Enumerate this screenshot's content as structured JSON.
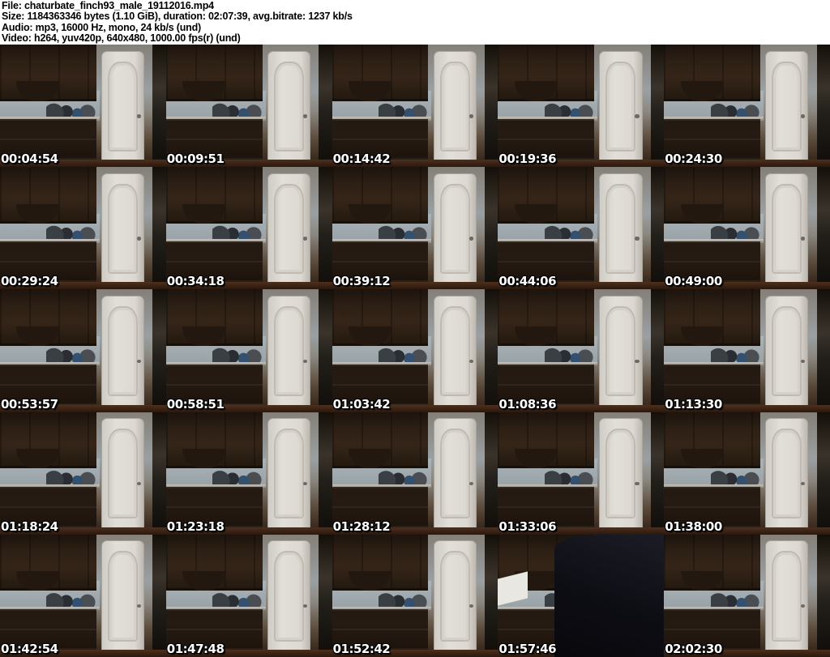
{
  "header": {
    "file_line": "File: chaturbate_finch93_male_19112016.mp4",
    "size_line": "Size: 1184363346 bytes (1.10 GiB), duration: 02:07:39, avg.bitrate: 1237 kb/s",
    "audio_line": "Audio: mp3, 16000 Hz, mono, 24 kb/s (und)",
    "video_line": "Video: h264, yuv420p, 640x480, 1000.00 fps(r) (und)"
  },
  "grid": {
    "columns": 5,
    "rows": 5,
    "thumbnails": [
      {
        "timestamp": "00:04:54",
        "variant": "kitchen"
      },
      {
        "timestamp": "00:09:51",
        "variant": "kitchen"
      },
      {
        "timestamp": "00:14:42",
        "variant": "kitchen"
      },
      {
        "timestamp": "00:19:36",
        "variant": "kitchen"
      },
      {
        "timestamp": "00:24:30",
        "variant": "kitchen"
      },
      {
        "timestamp": "00:29:24",
        "variant": "kitchen"
      },
      {
        "timestamp": "00:34:18",
        "variant": "kitchen"
      },
      {
        "timestamp": "00:39:12",
        "variant": "kitchen"
      },
      {
        "timestamp": "00:44:06",
        "variant": "kitchen"
      },
      {
        "timestamp": "00:49:00",
        "variant": "kitchen"
      },
      {
        "timestamp": "00:53:57",
        "variant": "kitchen"
      },
      {
        "timestamp": "00:58:51",
        "variant": "kitchen"
      },
      {
        "timestamp": "01:03:42",
        "variant": "kitchen"
      },
      {
        "timestamp": "01:08:36",
        "variant": "kitchen"
      },
      {
        "timestamp": "01:13:30",
        "variant": "kitchen"
      },
      {
        "timestamp": "01:18:24",
        "variant": "kitchen"
      },
      {
        "timestamp": "01:23:18",
        "variant": "kitchen"
      },
      {
        "timestamp": "01:28:12",
        "variant": "kitchen"
      },
      {
        "timestamp": "01:33:06",
        "variant": "kitchen"
      },
      {
        "timestamp": "01:38:00",
        "variant": "kitchen"
      },
      {
        "timestamp": "01:42:54",
        "variant": "kitchen"
      },
      {
        "timestamp": "01:47:48",
        "variant": "kitchen"
      },
      {
        "timestamp": "01:52:42",
        "variant": "kitchen"
      },
      {
        "timestamp": "01:57:46",
        "variant": "dark"
      },
      {
        "timestamp": "02:02:30",
        "variant": "kitchen"
      }
    ]
  },
  "colors": {
    "page_background": "#ffffff",
    "header_text": "#000000",
    "timestamp_text": "#ffffff",
    "timestamp_outline": "#000000",
    "cabinet_dark": "#2c1f14",
    "door_white": "#dcd8d1",
    "floor_brown": "#3a2414"
  }
}
